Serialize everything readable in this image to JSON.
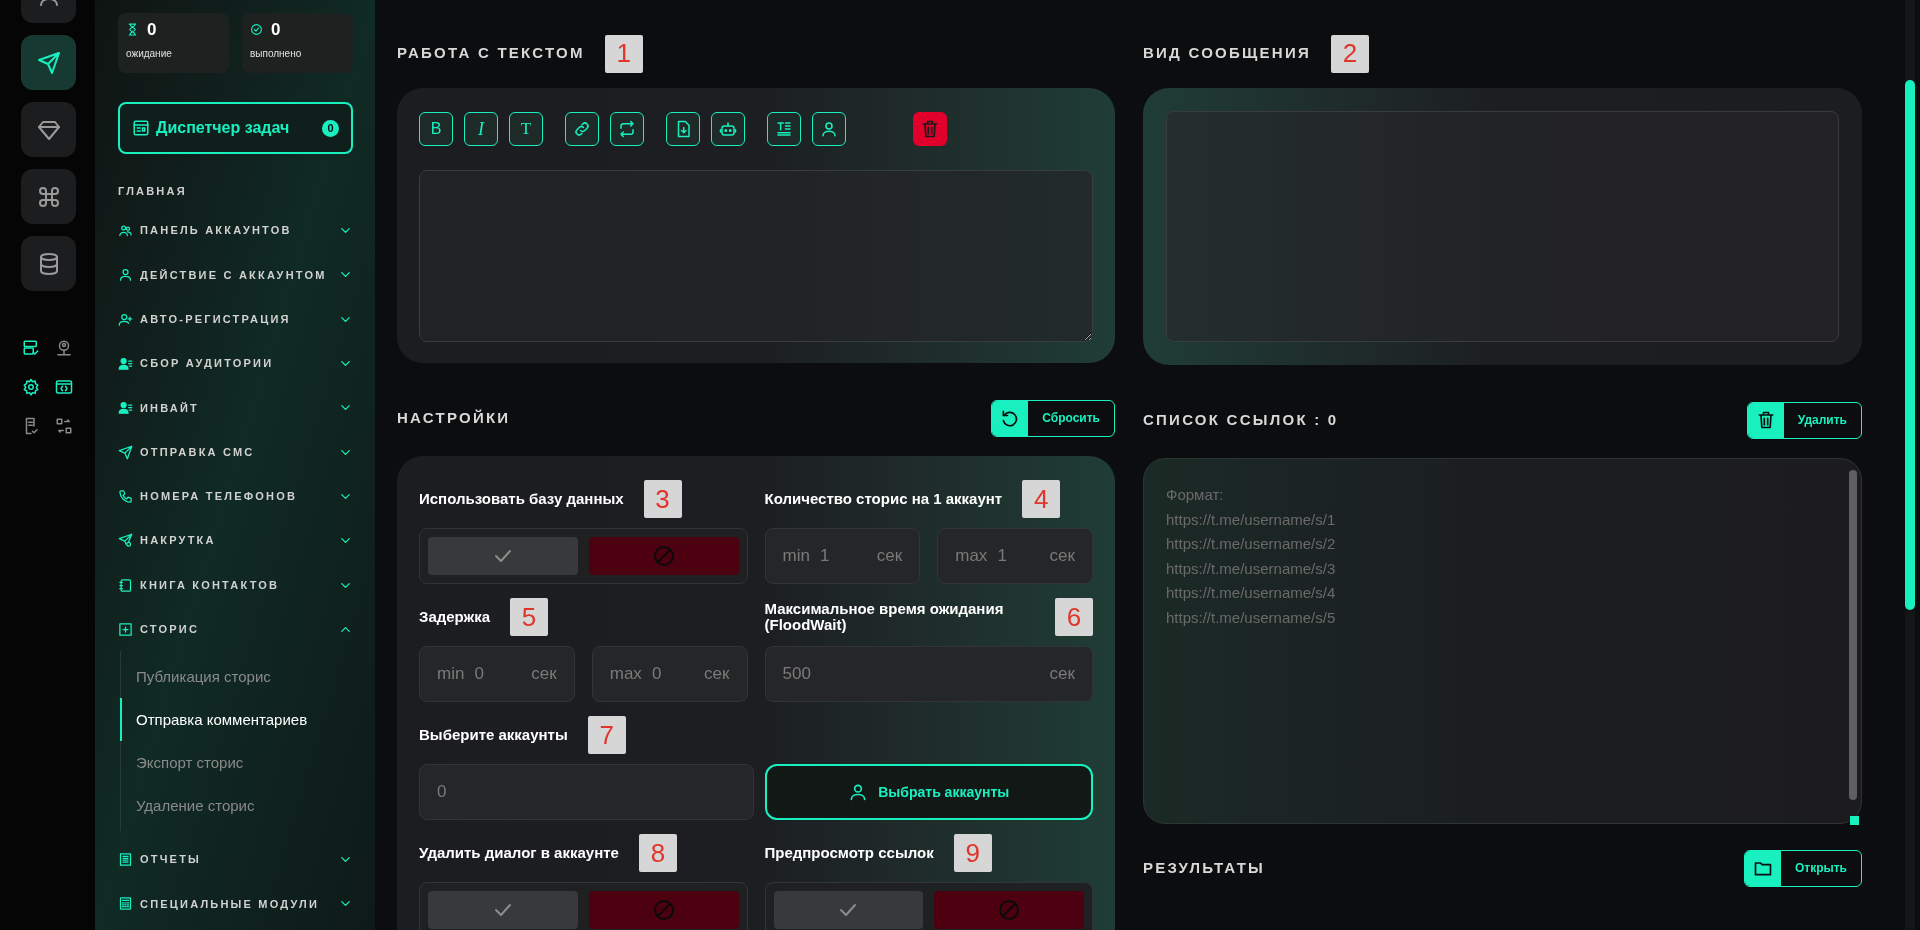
{
  "rail": {
    "items": [
      {
        "kind": "user",
        "selected": false
      },
      {
        "kind": "send",
        "selected": true
      },
      {
        "kind": "diamond",
        "selected": false
      },
      {
        "kind": "command",
        "selected": false
      },
      {
        "kind": "database",
        "selected": false
      }
    ],
    "tools": [
      {
        "kind": "server-check",
        "selected": true
      },
      {
        "kind": "user-pin",
        "selected": false
      },
      {
        "kind": "gear",
        "selected": true
      },
      {
        "kind": "code",
        "selected": true
      },
      {
        "kind": "doc-check",
        "selected": false
      },
      {
        "kind": "swap",
        "selected": false
      }
    ]
  },
  "sidebar": {
    "stats": [
      {
        "kind": "hourglass",
        "value": "0",
        "label": "ожидание"
      },
      {
        "kind": "check-circle",
        "value": "0",
        "label": "выполнено"
      }
    ],
    "dispatcher": {
      "label": "Диспетчер задач",
      "count": "0"
    },
    "section": "ГЛАВНАЯ",
    "items": [
      {
        "kind": "users",
        "label": "ПАНЕЛЬ АККАУНТОВ",
        "expanded": false
      },
      {
        "kind": "user",
        "label": "ДЕЙСТВИЕ С АККАУНТОМ",
        "expanded": false
      },
      {
        "kind": "user-plus",
        "label": "АВТО-РЕГИСТРАЦИЯ",
        "expanded": false
      },
      {
        "kind": "user-list",
        "label": "СБОР АУДИТОРИИ",
        "expanded": false
      },
      {
        "kind": "user-list",
        "label": "ИНВАЙТ",
        "expanded": false
      },
      {
        "kind": "send",
        "label": "ОТПРАВКА СМС",
        "expanded": false
      },
      {
        "kind": "phone",
        "label": "НОМЕРА ТЕЛЕФОНОВ",
        "expanded": false
      },
      {
        "kind": "send-plus",
        "label": "НАКРУТКА",
        "expanded": false
      },
      {
        "kind": "book",
        "label": "КНИГА КОНТАКТОВ",
        "expanded": false
      },
      {
        "kind": "plus-square",
        "label": "СТОРИС",
        "expanded": true,
        "children": [
          {
            "label": "Публикация сторис",
            "selected": false
          },
          {
            "label": "Отправка комментариев",
            "selected": true
          },
          {
            "label": "Экспорт сторис",
            "selected": false
          },
          {
            "label": "Удаление сторис",
            "selected": false
          }
        ]
      },
      {
        "kind": "report",
        "label": "ОТЧЕТЫ",
        "expanded": false
      },
      {
        "kind": "calculator",
        "label": "СПЕЦИАЛЬНЫЕ МОДУЛИ",
        "expanded": false
      }
    ]
  },
  "editor": {
    "title": "РАБОТА С ТЕКСТОМ",
    "callout": "1",
    "toolbar_groups": [
      [
        {
          "kind": "bold",
          "label": "B"
        },
        {
          "kind": "italic",
          "label": "I"
        },
        {
          "kind": "text",
          "label": "T"
        }
      ],
      [
        {
          "kind": "link"
        },
        {
          "kind": "repeat"
        }
      ],
      [
        {
          "kind": "file-download"
        },
        {
          "kind": "robot"
        }
      ],
      [
        {
          "kind": "text-format"
        },
        {
          "kind": "user"
        }
      ]
    ],
    "clear_button": {
      "kind": "trash"
    }
  },
  "settings": {
    "title": "НАСТРОЙКИ",
    "reset_button": "Сбросить",
    "fields": [
      {
        "kind": "toggle",
        "label": "Использовать базу данных",
        "callout": "3",
        "checked": false
      },
      {
        "kind": "range",
        "label": "Количество сторис на 1 аккаунт",
        "callout": "4",
        "min": {
          "prefix": "min",
          "placeholder": "1",
          "unit": "сек"
        },
        "max": {
          "prefix": "max",
          "placeholder": "1",
          "unit": "сек"
        }
      },
      {
        "kind": "range",
        "label": "Задержка",
        "callout": "5",
        "min": {
          "prefix": "min",
          "placeholder": "0",
          "unit": "сек"
        },
        "max": {
          "prefix": "max",
          "placeholder": "0",
          "unit": "сек"
        }
      },
      {
        "kind": "number",
        "label": "Максимальное время ожидания (FloodWait)",
        "callout": "6",
        "placeholder": "500",
        "unit": "сек"
      },
      {
        "kind": "text",
        "label": "Выберите аккаунты",
        "callout": "7",
        "placeholder": "0"
      },
      {
        "kind": "button",
        "label": "Выбрать аккаунты"
      },
      {
        "kind": "toggle",
        "label": "Удалить диалог в аккаунте",
        "callout": "8",
        "checked": false
      },
      {
        "kind": "toggle",
        "label": "Предпросмотр ссылок",
        "callout": "9",
        "checked": false
      }
    ]
  },
  "preview": {
    "title": "ВИД СООБЩЕНИЯ",
    "callout": "2"
  },
  "links": {
    "title": "СПИСОК ССЫЛОК : 0",
    "delete_button": "Удалить",
    "placeholder": "Формат:\nhttps://t.me/username/s/1\nhttps://t.me/username/s/2\nhttps://t.me/username/s/3\nhttps://t.me/username/s/4\nhttps://t.me/username/s/5"
  },
  "results": {
    "title": "РЕЗУЛЬТАТЫ",
    "open_button": "Открыть"
  }
}
